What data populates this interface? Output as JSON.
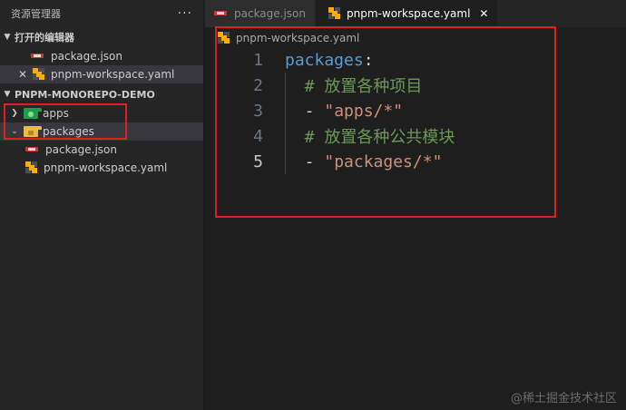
{
  "explorer": {
    "title": "资源管理器",
    "more_label": "···",
    "open_editors": {
      "label": "打开的编辑器",
      "items": [
        {
          "name": "package.json",
          "icon": "npm-json-icon"
        },
        {
          "name": "pnpm-workspace.yaml",
          "icon": "yaml-icon",
          "close": "✕"
        }
      ]
    },
    "project": {
      "label": "PNPM-MONOREPO-DEMO",
      "items": [
        {
          "name": "apps",
          "icon": "folder-green-icon"
        },
        {
          "name": "packages",
          "icon": "folder-yellow-icon"
        },
        {
          "name": "package.json",
          "icon": "npm-json-icon"
        },
        {
          "name": "pnpm-workspace.yaml",
          "icon": "yaml-icon"
        }
      ]
    }
  },
  "tabs": [
    {
      "label": "package.json",
      "active": false
    },
    {
      "label": "pnpm-workspace.yaml",
      "active": true,
      "close": "✕"
    }
  ],
  "breadcrumb": "pnpm-workspace.yaml",
  "code": {
    "lines": [
      {
        "num": "1",
        "key": "packages",
        "punct": ":"
      },
      {
        "num": "2",
        "comment": "  # 放置各种项目"
      },
      {
        "num": "3",
        "dash": "  - ",
        "str": "\"apps/*\""
      },
      {
        "num": "4",
        "comment": "  # 放置各种公共模块"
      },
      {
        "num": "5",
        "dash": "  - ",
        "str": "\"packages/*\""
      }
    ]
  },
  "watermark": "@稀土掘金技术社区",
  "colors": {
    "highlight": "#e02020",
    "key": "#569cd6",
    "comment": "#6a9955",
    "string": "#ce9178"
  }
}
